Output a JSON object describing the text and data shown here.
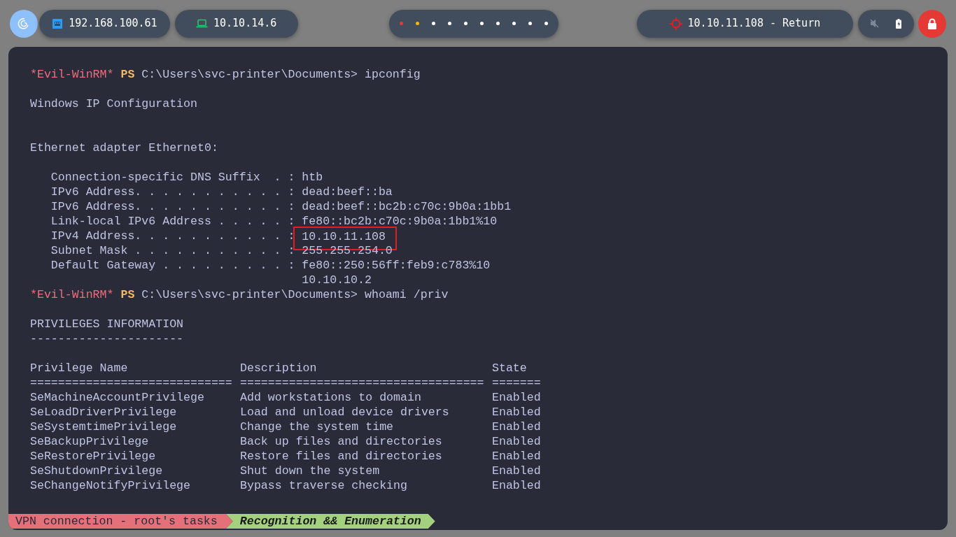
{
  "top_bar": {
    "workspaces": [
      {
        "color": "#e53935"
      },
      {
        "color": "#f6b900"
      },
      {
        "color": "#ffffff"
      },
      {
        "color": "#ffffff"
      },
      {
        "color": "#ffffff"
      },
      {
        "color": "#ffffff"
      },
      {
        "color": "#ffffff"
      },
      {
        "color": "#ffffff"
      },
      {
        "color": "#ffffff"
      },
      {
        "color": "#ffffff"
      }
    ],
    "ethernet_ip": "192.168.100.61",
    "vpn_ip": "10.10.14.6",
    "target": "10.10.11.108 - Return"
  },
  "terminal": {
    "lines": [
      {
        "kind": "prompt",
        "user": "*Evil-WinRM*",
        "shell": "PS",
        "path": "C:\\Users\\svc-printer\\Documents>",
        "command": "ipconfig"
      },
      {
        "kind": "blank"
      },
      {
        "kind": "output",
        "text": "Windows IP Configuration"
      },
      {
        "kind": "blank"
      },
      {
        "kind": "blank"
      },
      {
        "kind": "output",
        "text": "Ethernet adapter Ethernet0:"
      },
      {
        "kind": "blank"
      },
      {
        "kind": "output",
        "text": "   Connection-specific DNS Suffix  . : htb"
      },
      {
        "kind": "output",
        "text": "   IPv6 Address. . . . . . . . . . . : dead:beef::ba"
      },
      {
        "kind": "output",
        "text": "   IPv6 Address. . . . . . . . . . . : dead:beef::bc2b:c70c:9b0a:1bb1"
      },
      {
        "kind": "output",
        "text": "   Link-local IPv6 Address . . . . . : fe80::bc2b:c70c:9b0a:1bb1%10"
      },
      {
        "kind": "output",
        "text": "   IPv4 Address. . . . . . . . . . . : ",
        "boxed": "10.10.11.108"
      },
      {
        "kind": "output",
        "text": "   Subnet Mask . . . . . . . . . . . : 255.255.254.0"
      },
      {
        "kind": "output",
        "text": "   Default Gateway . . . . . . . . . : fe80::250:56ff:feb9:c783%10"
      },
      {
        "kind": "output",
        "text": "                                       10.10.10.2"
      },
      {
        "kind": "prompt",
        "user": "*Evil-WinRM*",
        "shell": "PS",
        "path": "C:\\Users\\svc-printer\\Documents>",
        "command": "whoami /priv"
      },
      {
        "kind": "blank"
      },
      {
        "kind": "output",
        "text": "PRIVILEGES INFORMATION"
      },
      {
        "kind": "output",
        "text": "----------------------"
      },
      {
        "kind": "blank"
      }
    ],
    "table": {
      "columns": [
        {
          "name": "Privilege Name",
          "rule": "============================="
        },
        {
          "name": "Description",
          "rule": "==================================="
        },
        {
          "name": "State",
          "rule": "======="
        }
      ],
      "rows": [
        [
          "SeMachineAccountPrivilege",
          "Add workstations to domain",
          "Enabled"
        ],
        [
          "SeLoadDriverPrivilege",
          "Load and unload device drivers",
          "Enabled"
        ],
        [
          "SeSystemtimePrivilege",
          "Change the system time",
          "Enabled"
        ],
        [
          "SeBackupPrivilege",
          "Back up files and directories",
          "Enabled"
        ],
        [
          "SeRestorePrivilege",
          "Restore files and directories",
          "Enabled"
        ],
        [
          "SeShutdownPrivilege",
          "Shut down the system",
          "Enabled"
        ],
        [
          "SeChangeNotifyPrivilege",
          "Bypass traverse checking",
          "Enabled"
        ]
      ]
    }
  },
  "status_line": {
    "session": "VPN connection - root's tasks",
    "window": "Recognition && Enumeration"
  }
}
